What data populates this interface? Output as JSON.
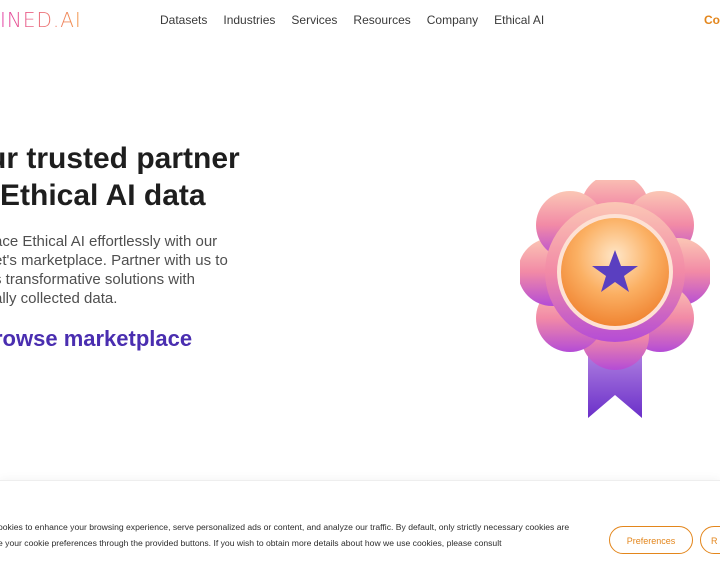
{
  "header": {
    "logo_text": "INED.AI",
    "nav": [
      "Datasets",
      "Industries",
      "Services",
      "Resources",
      "Company",
      "Ethical AI"
    ],
    "cta_label": "Co"
  },
  "hero": {
    "title_line1": "ur trusted partner",
    "title_line2": "Ethical AI data",
    "desc_lines": [
      "ace Ethical AI effortlessly with our",
      "et's marketplace. Partner with us to",
      "s transformative solutions with",
      "ally collected data."
    ],
    "browse_label": "rowse marketplace"
  },
  "badge": {
    "icon": "star-icon",
    "colors": {
      "petals_top": "#f7b3a3",
      "petals_bottom": "#b44cd6",
      "center": "#f59a3d",
      "star": "#5a3fc0",
      "ribbon": "#7b3fd1"
    }
  },
  "cookie": {
    "line1": "ookies to enhance your browsing experience, serve personalized ads or content, and analyze our traffic. By default, only strictly necessary cookies are",
    "line2": "e your cookie preferences through the provided buttons. If you wish to obtain more details about how we use cookies, please consult",
    "preferences_label": "Preferences",
    "second_label": "R"
  },
  "colors": {
    "accent": "#e3861c",
    "brand_purple": "#4a2eb0"
  }
}
